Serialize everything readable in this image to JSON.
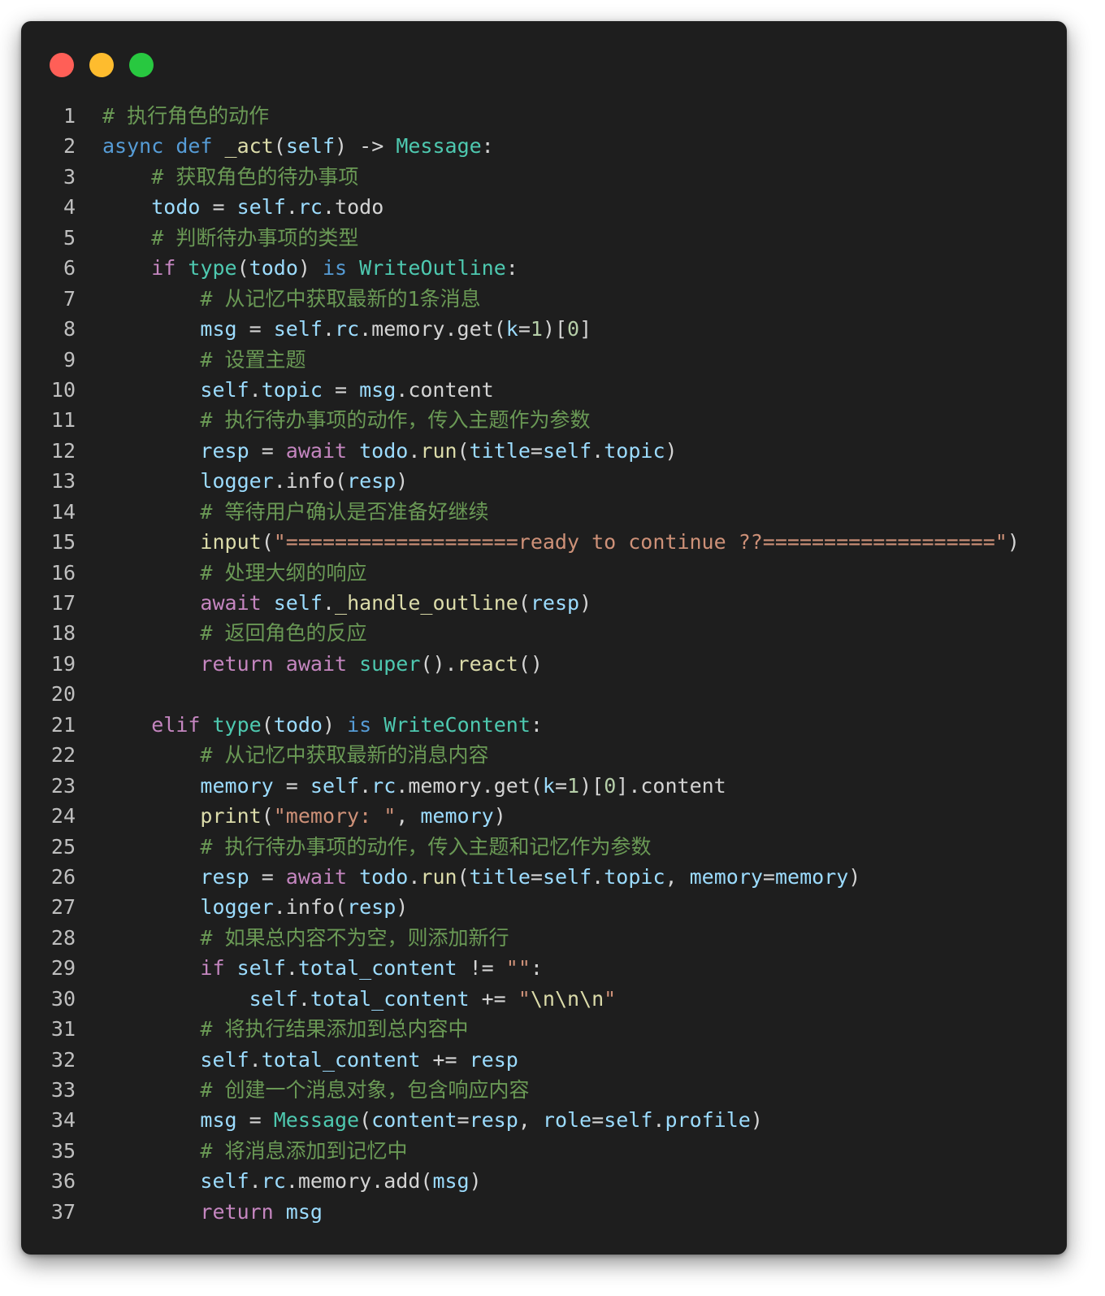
{
  "window": {
    "controls": [
      "close",
      "minimize",
      "maximize"
    ],
    "colors": {
      "close": "#ff5f57",
      "minimize": "#febc2e",
      "maximize": "#28c840",
      "background": "#1e1e1e"
    }
  },
  "editor": {
    "language": "python",
    "lines": [
      {
        "n": "1",
        "tokens": [
          [
            "cm",
            "# 执行角色的动作"
          ]
        ]
      },
      {
        "n": "2",
        "tokens": [
          [
            "kw",
            "async"
          ],
          [
            "pl",
            " "
          ],
          [
            "kw",
            "def"
          ],
          [
            "pl",
            " "
          ],
          [
            "fn",
            "_act"
          ],
          [
            "pl",
            "("
          ],
          [
            "var",
            "self"
          ],
          [
            "pl",
            ") -> "
          ],
          [
            "ty",
            "Message"
          ],
          [
            "pl",
            ":"
          ]
        ]
      },
      {
        "n": "3",
        "tokens": [
          [
            "pl",
            "    "
          ],
          [
            "cm",
            "# 获取角色的待办事项"
          ]
        ]
      },
      {
        "n": "4",
        "tokens": [
          [
            "pl",
            "    "
          ],
          [
            "var",
            "todo"
          ],
          [
            "pl",
            " = "
          ],
          [
            "var",
            "self"
          ],
          [
            "pl",
            "."
          ],
          [
            "var",
            "rc"
          ],
          [
            "pl",
            ".todo"
          ]
        ]
      },
      {
        "n": "5",
        "tokens": [
          [
            "pl",
            "    "
          ],
          [
            "cm",
            "# 判断待办事项的类型"
          ]
        ]
      },
      {
        "n": "6",
        "tokens": [
          [
            "pl",
            "    "
          ],
          [
            "ctl",
            "if"
          ],
          [
            "pl",
            " "
          ],
          [
            "ty",
            "type"
          ],
          [
            "pl",
            "("
          ],
          [
            "var",
            "todo"
          ],
          [
            "pl",
            ") "
          ],
          [
            "kw",
            "is"
          ],
          [
            "pl",
            " "
          ],
          [
            "ty",
            "WriteOutline"
          ],
          [
            "pl",
            ":"
          ]
        ]
      },
      {
        "n": "7",
        "tokens": [
          [
            "pl",
            "        "
          ],
          [
            "cm",
            "# 从记忆中获取最新的1条消息"
          ]
        ]
      },
      {
        "n": "8",
        "tokens": [
          [
            "pl",
            "        "
          ],
          [
            "var",
            "msg"
          ],
          [
            "pl",
            " = "
          ],
          [
            "var",
            "self"
          ],
          [
            "pl",
            "."
          ],
          [
            "var",
            "rc"
          ],
          [
            "pl",
            ".memory.get("
          ],
          [
            "var",
            "k"
          ],
          [
            "pl",
            "="
          ],
          [
            "num",
            "1"
          ],
          [
            "pl",
            ")["
          ],
          [
            "num",
            "0"
          ],
          [
            "pl",
            "]"
          ]
        ]
      },
      {
        "n": "9",
        "tokens": [
          [
            "pl",
            "        "
          ],
          [
            "cm",
            "# 设置主题"
          ]
        ]
      },
      {
        "n": "10",
        "tokens": [
          [
            "pl",
            "        "
          ],
          [
            "var",
            "self"
          ],
          [
            "pl",
            "."
          ],
          [
            "var",
            "topic"
          ],
          [
            "pl",
            " = "
          ],
          [
            "var",
            "msg"
          ],
          [
            "pl",
            ".content"
          ]
        ]
      },
      {
        "n": "11",
        "tokens": [
          [
            "pl",
            "        "
          ],
          [
            "cm",
            "# 执行待办事项的动作，传入主题作为参数"
          ]
        ]
      },
      {
        "n": "12",
        "tokens": [
          [
            "pl",
            "        "
          ],
          [
            "var",
            "resp"
          ],
          [
            "pl",
            " = "
          ],
          [
            "ctl",
            "await"
          ],
          [
            "pl",
            " "
          ],
          [
            "var",
            "todo"
          ],
          [
            "pl",
            "."
          ],
          [
            "fn",
            "run"
          ],
          [
            "pl",
            "("
          ],
          [
            "var",
            "title"
          ],
          [
            "pl",
            "="
          ],
          [
            "var",
            "self"
          ],
          [
            "pl",
            "."
          ],
          [
            "var",
            "topic"
          ],
          [
            "pl",
            ")"
          ]
        ]
      },
      {
        "n": "13",
        "tokens": [
          [
            "pl",
            "        "
          ],
          [
            "var",
            "logger"
          ],
          [
            "pl",
            ".info("
          ],
          [
            "var",
            "resp"
          ],
          [
            "pl",
            ")"
          ]
        ]
      },
      {
        "n": "14",
        "tokens": [
          [
            "pl",
            "        "
          ],
          [
            "cm",
            "# 等待用户确认是否准备好继续"
          ]
        ]
      },
      {
        "n": "15",
        "tokens": [
          [
            "pl",
            "        "
          ],
          [
            "fn",
            "input"
          ],
          [
            "pl",
            "("
          ],
          [
            "str",
            "\"===================ready to continue ??===================\""
          ],
          [
            "pl",
            ")"
          ]
        ]
      },
      {
        "n": "16",
        "tokens": [
          [
            "pl",
            "        "
          ],
          [
            "cm",
            "# 处理大纲的响应"
          ]
        ]
      },
      {
        "n": "17",
        "tokens": [
          [
            "pl",
            "        "
          ],
          [
            "ctl",
            "await"
          ],
          [
            "pl",
            " "
          ],
          [
            "var",
            "self"
          ],
          [
            "pl",
            "."
          ],
          [
            "fn",
            "_handle_outline"
          ],
          [
            "pl",
            "("
          ],
          [
            "var",
            "resp"
          ],
          [
            "pl",
            ")"
          ]
        ]
      },
      {
        "n": "18",
        "tokens": [
          [
            "pl",
            "        "
          ],
          [
            "cm",
            "# 返回角色的反应"
          ]
        ]
      },
      {
        "n": "19",
        "tokens": [
          [
            "pl",
            "        "
          ],
          [
            "ctl",
            "return"
          ],
          [
            "pl",
            " "
          ],
          [
            "ctl",
            "await"
          ],
          [
            "pl",
            " "
          ],
          [
            "ty",
            "super"
          ],
          [
            "pl",
            "()."
          ],
          [
            "fn",
            "react"
          ],
          [
            "pl",
            "()"
          ]
        ]
      },
      {
        "n": "20",
        "tokens": []
      },
      {
        "n": "21",
        "tokens": [
          [
            "pl",
            "    "
          ],
          [
            "ctl",
            "elif"
          ],
          [
            "pl",
            " "
          ],
          [
            "ty",
            "type"
          ],
          [
            "pl",
            "("
          ],
          [
            "var",
            "todo"
          ],
          [
            "pl",
            ") "
          ],
          [
            "kw",
            "is"
          ],
          [
            "pl",
            " "
          ],
          [
            "ty",
            "WriteContent"
          ],
          [
            "pl",
            ":"
          ]
        ]
      },
      {
        "n": "22",
        "tokens": [
          [
            "pl",
            "        "
          ],
          [
            "cm",
            "# 从记忆中获取最新的消息内容"
          ]
        ]
      },
      {
        "n": "23",
        "tokens": [
          [
            "pl",
            "        "
          ],
          [
            "var",
            "memory"
          ],
          [
            "pl",
            " = "
          ],
          [
            "var",
            "self"
          ],
          [
            "pl",
            "."
          ],
          [
            "var",
            "rc"
          ],
          [
            "pl",
            ".memory.get("
          ],
          [
            "var",
            "k"
          ],
          [
            "pl",
            "="
          ],
          [
            "num",
            "1"
          ],
          [
            "pl",
            ")["
          ],
          [
            "num",
            "0"
          ],
          [
            "pl",
            "].content"
          ]
        ]
      },
      {
        "n": "24",
        "tokens": [
          [
            "pl",
            "        "
          ],
          [
            "fn",
            "print"
          ],
          [
            "pl",
            "("
          ],
          [
            "str",
            "\"memory: \""
          ],
          [
            "pl",
            ", "
          ],
          [
            "var",
            "memory"
          ],
          [
            "pl",
            ")"
          ]
        ]
      },
      {
        "n": "25",
        "tokens": [
          [
            "pl",
            "        "
          ],
          [
            "cm",
            "# 执行待办事项的动作，传入主题和记忆作为参数"
          ]
        ]
      },
      {
        "n": "26",
        "tokens": [
          [
            "pl",
            "        "
          ],
          [
            "var",
            "resp"
          ],
          [
            "pl",
            " = "
          ],
          [
            "ctl",
            "await"
          ],
          [
            "pl",
            " "
          ],
          [
            "var",
            "todo"
          ],
          [
            "pl",
            "."
          ],
          [
            "fn",
            "run"
          ],
          [
            "pl",
            "("
          ],
          [
            "var",
            "title"
          ],
          [
            "pl",
            "="
          ],
          [
            "var",
            "self"
          ],
          [
            "pl",
            "."
          ],
          [
            "var",
            "topic"
          ],
          [
            "pl",
            ", "
          ],
          [
            "var",
            "memory"
          ],
          [
            "pl",
            "="
          ],
          [
            "var",
            "memory"
          ],
          [
            "pl",
            ")"
          ]
        ]
      },
      {
        "n": "27",
        "tokens": [
          [
            "pl",
            "        "
          ],
          [
            "var",
            "logger"
          ],
          [
            "pl",
            ".info("
          ],
          [
            "var",
            "resp"
          ],
          [
            "pl",
            ")"
          ]
        ]
      },
      {
        "n": "28",
        "tokens": [
          [
            "pl",
            "        "
          ],
          [
            "cm",
            "# 如果总内容不为空，则添加新行"
          ]
        ]
      },
      {
        "n": "29",
        "tokens": [
          [
            "pl",
            "        "
          ],
          [
            "ctl",
            "if"
          ],
          [
            "pl",
            " "
          ],
          [
            "var",
            "self"
          ],
          [
            "pl",
            "."
          ],
          [
            "var",
            "total_content"
          ],
          [
            "pl",
            " != "
          ],
          [
            "str",
            "\"\""
          ],
          [
            "pl",
            ":"
          ]
        ]
      },
      {
        "n": "30",
        "tokens": [
          [
            "pl",
            "            "
          ],
          [
            "var",
            "self"
          ],
          [
            "pl",
            "."
          ],
          [
            "var",
            "total_content"
          ],
          [
            "pl",
            " += "
          ],
          [
            "str",
            "\""
          ],
          [
            "fn",
            "\\n\\n\\n"
          ],
          [
            "str",
            "\""
          ]
        ]
      },
      {
        "n": "31",
        "tokens": [
          [
            "pl",
            "        "
          ],
          [
            "cm",
            "# 将执行结果添加到总内容中"
          ]
        ]
      },
      {
        "n": "32",
        "tokens": [
          [
            "pl",
            "        "
          ],
          [
            "var",
            "self"
          ],
          [
            "pl",
            "."
          ],
          [
            "var",
            "total_content"
          ],
          [
            "pl",
            " += "
          ],
          [
            "var",
            "resp"
          ]
        ]
      },
      {
        "n": "33",
        "tokens": [
          [
            "pl",
            "        "
          ],
          [
            "cm",
            "# 创建一个消息对象，包含响应内容"
          ]
        ]
      },
      {
        "n": "34",
        "tokens": [
          [
            "pl",
            "        "
          ],
          [
            "var",
            "msg"
          ],
          [
            "pl",
            " = "
          ],
          [
            "ty",
            "Message"
          ],
          [
            "pl",
            "("
          ],
          [
            "var",
            "content"
          ],
          [
            "pl",
            "="
          ],
          [
            "var",
            "resp"
          ],
          [
            "pl",
            ", "
          ],
          [
            "var",
            "role"
          ],
          [
            "pl",
            "="
          ],
          [
            "var",
            "self"
          ],
          [
            "pl",
            "."
          ],
          [
            "var",
            "profile"
          ],
          [
            "pl",
            ")"
          ]
        ]
      },
      {
        "n": "35",
        "tokens": [
          [
            "pl",
            "        "
          ],
          [
            "cm",
            "# 将消息添加到记忆中"
          ]
        ]
      },
      {
        "n": "36",
        "tokens": [
          [
            "pl",
            "        "
          ],
          [
            "var",
            "self"
          ],
          [
            "pl",
            "."
          ],
          [
            "var",
            "rc"
          ],
          [
            "pl",
            ".memory.add("
          ],
          [
            "var",
            "msg"
          ],
          [
            "pl",
            ")"
          ]
        ]
      },
      {
        "n": "37",
        "tokens": [
          [
            "pl",
            "        "
          ],
          [
            "ctl",
            "return"
          ],
          [
            "pl",
            " "
          ],
          [
            "var",
            "msg"
          ]
        ]
      }
    ]
  }
}
